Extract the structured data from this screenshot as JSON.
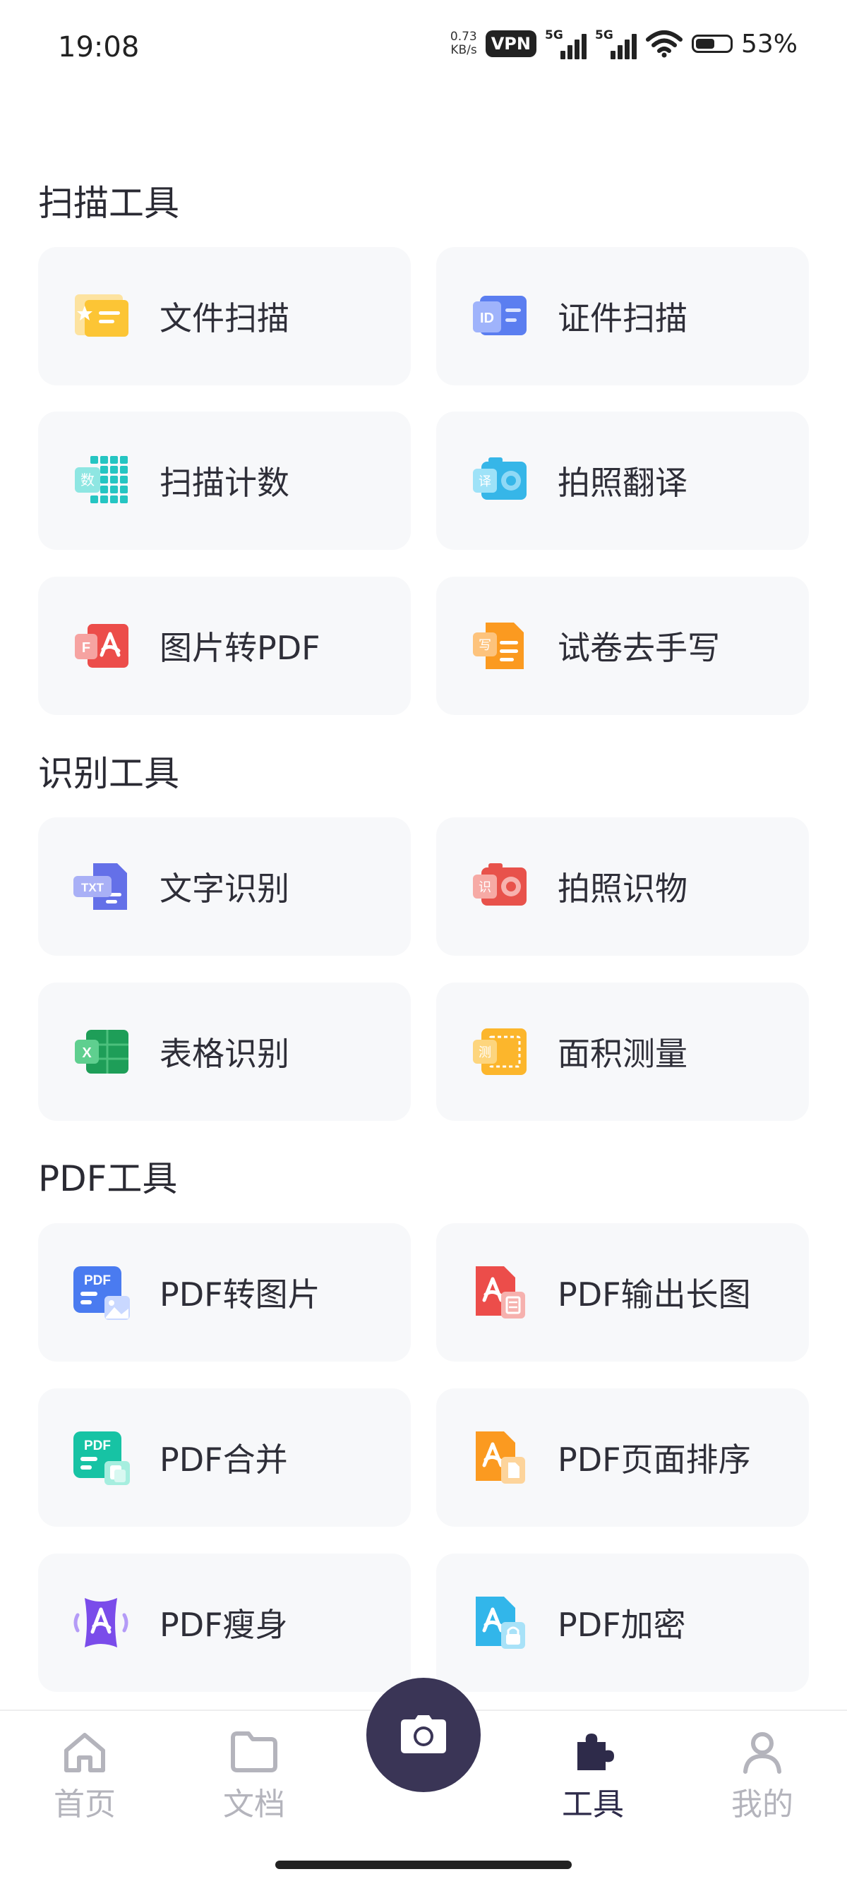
{
  "status": {
    "time": "19:08",
    "speed_value": "0.73",
    "speed_unit": "KB/s",
    "vpn": "VPN",
    "net1": "5G",
    "net2": "5G",
    "battery": "53%"
  },
  "sections": {
    "scan": {
      "title": "扫描工具",
      "items": [
        "文件扫描",
        "证件扫描",
        "扫描计数",
        "拍照翻译",
        "图片转PDF",
        "试卷去手写"
      ]
    },
    "recognize": {
      "title": "识别工具",
      "items": [
        "文字识别",
        "拍照识物",
        "表格识别",
        "面积测量"
      ]
    },
    "pdf": {
      "title": "PDF工具",
      "items": [
        "PDF转图片",
        "PDF输出长图",
        "PDF合并",
        "PDF页面排序",
        "PDF瘦身",
        "PDF加密"
      ]
    }
  },
  "icons": {
    "doc_scan": "folder-star-icon",
    "id_scan": "id-card-icon",
    "count": "grid-count-icon",
    "translate": "camera-translate-icon",
    "img2pdf": "image-to-pdf-icon",
    "erase": "exam-erase-icon",
    "ocr": "txt-icon",
    "object": "camera-recognize-icon",
    "table": "excel-icon",
    "measure": "measure-icon",
    "pdf2img": "pdf-image-icon",
    "pdflong": "pdf-long-image-icon",
    "merge": "pdf-merge-icon",
    "sort": "pdf-sort-icon",
    "compress": "pdf-compress-icon",
    "encrypt": "pdf-lock-icon"
  },
  "glyphs": {
    "id": "ID",
    "count": "数",
    "translate": "译",
    "img2pdf": "F",
    "erase": "写",
    "ocr": "TXT",
    "object": "识",
    "table": "X",
    "measure": "测",
    "pdf": "PDF"
  },
  "nav": {
    "home": "首页",
    "docs": "文档",
    "tools": "工具",
    "mine": "我的",
    "active": "tools"
  },
  "colors": {
    "active": "#2e2b4a",
    "inactive": "#b4b4bc",
    "card": "#f7f8fa",
    "camera": "#3a3556"
  }
}
